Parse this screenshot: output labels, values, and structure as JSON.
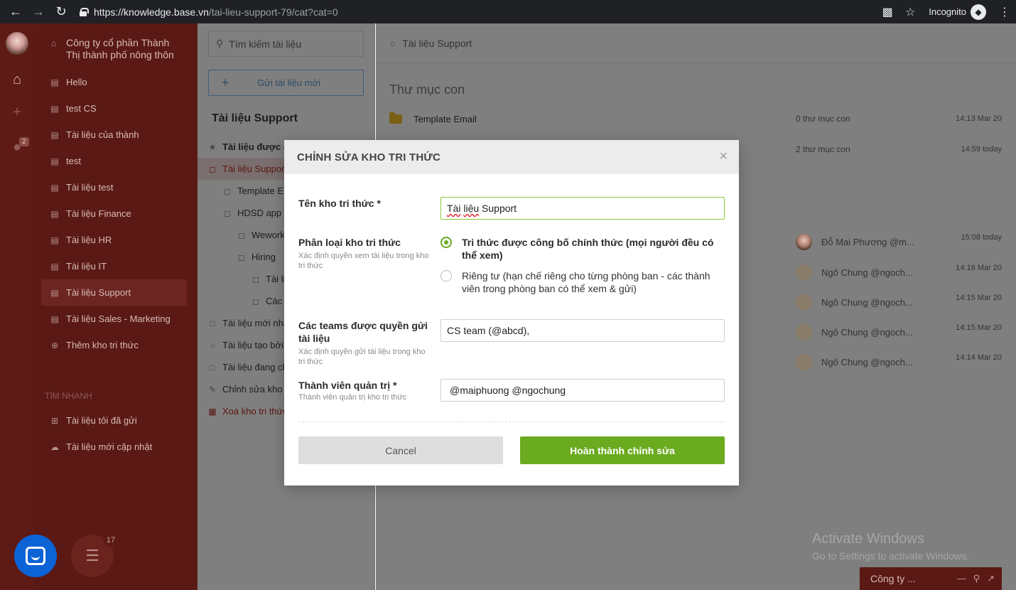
{
  "browser": {
    "url_host": "https://knowledge.base.vn",
    "url_path": "/tai-lieu-support-79/cat?cat=0",
    "incognito_label": "Incognito"
  },
  "rail": {
    "notification_count": "2"
  },
  "sidebar": {
    "org_name_line1": "Công ty cổ phần Thành",
    "org_name_line2": "Thị thành phố nông thôn",
    "items": [
      {
        "label": "Hello"
      },
      {
        "label": "test CS"
      },
      {
        "label": "Tài liệu của thành"
      },
      {
        "label": "test"
      },
      {
        "label": "Tài liệu test"
      },
      {
        "label": "Tài liệu Finance"
      },
      {
        "label": "Tài liệu HR"
      },
      {
        "label": "Tài liệu IT"
      },
      {
        "label": "Tài liệu Support"
      },
      {
        "label": "Tài liệu Sales - Marketing"
      },
      {
        "label": "Thêm kho tri thức"
      }
    ],
    "quick_title": "TÌM NHANH",
    "quick_items": [
      {
        "label": "Tài liệu tôi đã gửi"
      },
      {
        "label": "Tài liệu mới cập nhật"
      }
    ]
  },
  "tree_panel": {
    "search_placeholder": "Tìm kiếm tài liệu",
    "upload_label": "Gửi tài liệu mới",
    "title": "Tài liệu Support",
    "items": [
      {
        "label": "Tài liệu được đ"
      },
      {
        "label": "Tài liệu Suppor"
      },
      {
        "label": "Template E"
      },
      {
        "label": "HDSD app E"
      },
      {
        "label": "Wework"
      },
      {
        "label": "Hiring"
      },
      {
        "label": "Tài li"
      },
      {
        "label": "Các l"
      },
      {
        "label": "Tài liệu mới nhấ"
      },
      {
        "label": "Tài liệu tạo bởi"
      },
      {
        "label": "Tài liệu đang ch"
      },
      {
        "label": "Chỉnh sửa kho"
      },
      {
        "label": "Xoá kho tri thức"
      }
    ]
  },
  "main": {
    "breadcrumb": "Tài liệu Support",
    "subfolders_title": "Thư mục con",
    "folders": [
      {
        "name": "Template Email",
        "count": "0 thư mục con",
        "time": "14:13 Mar 20"
      },
      {
        "name": "",
        "count": "2 thư mục con",
        "time": "14:59 today"
      }
    ],
    "docs": [
      {
        "user": "Đỗ Mai Phương @m...",
        "time": "15:08 today"
      },
      {
        "user": "Ngô Chung @ngoch...",
        "time": "14:16 Mar 20"
      },
      {
        "user": "Ngô Chung @ngoch...",
        "time": "14:15 Mar 20"
      },
      {
        "user": "Ngô Chung @ngoch...",
        "time": "14:15 Mar 20"
      },
      {
        "user": "Ngô Chung @ngoch...",
        "time": "14:14 Mar 20"
      }
    ],
    "watermark_line1": "Activate Windows",
    "watermark_line2": "Go to Settings to activate Windows.",
    "company_bar": "Công ty ..."
  },
  "floating": {
    "task_badge": "17"
  },
  "modal": {
    "title": "CHỈNH SỬA KHO TRI THỨC",
    "name_label": "Tên kho tri thức *",
    "name_value_word": "Tài",
    "name_value_word2": "liệu",
    "name_value_rest": " Support",
    "type_label": "Phân loại kho tri thức",
    "type_sub": "Xác định quyền xem tài liệu trong kho tri thức",
    "option_public": "Tri thức được công bố chính thức (mọi người đều có thể xem)",
    "option_private": "Riêng tư (hạn chế riêng cho từng phòng ban - các thành viên trong phòng ban có thể xem & gửi)",
    "teams_label": "Các teams được quyền gửi tài liệu",
    "teams_sub": "Xác định quyền gửi tài liệu trong kho tri thức",
    "teams_value": "CS team (@abcd),",
    "admins_label": "Thành viên quản trị *",
    "admins_sub": "Thành viên quản trị kho tri thức",
    "admins_value": "@maiphuong @ngochung",
    "cancel_label": "Cancel",
    "submit_label": "Hoàn thành chỉnh sửa"
  }
}
